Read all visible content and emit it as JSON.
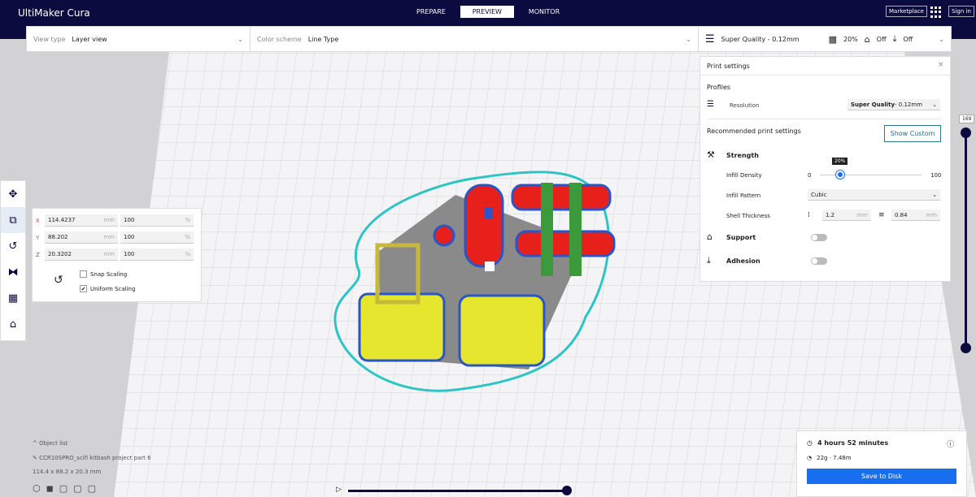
{
  "app": {
    "title": "UltiMaker Cura",
    "nav": [
      "PREPARE",
      "PREVIEW",
      "MONITOR"
    ],
    "active": "PREVIEW",
    "marketplace": "Marketplace",
    "signin": "Sign in"
  },
  "viewbar": {
    "view_type_label": "View type",
    "view_type": "Layer view",
    "color_scheme_label": "Color scheme",
    "color_scheme": "Line Type"
  },
  "summary": {
    "profile": "Super Quality - 0.12mm",
    "infill": "20%",
    "support": "Off",
    "adhesion": "Off"
  },
  "print_settings": {
    "title": "Print settings",
    "profiles": "Profiles",
    "resolution_label": "Resolution",
    "resolution_bold": "Super Quality",
    "resolution_rest": " - 0.12mm",
    "recommended": "Recommended print settings",
    "show_custom": "Show Custom",
    "strength": "Strength",
    "infill_density": "Infill Density",
    "infill_min": "0",
    "infill_max": "100",
    "infill_value": "20%",
    "infill_percent": 20,
    "infill_pattern_label": "Infill Pattern",
    "infill_pattern": "Cubic",
    "shell_label": "Shell Thickness",
    "wall": "1.2",
    "top_bottom": "0.84",
    "unit": "mm",
    "support": "Support",
    "support_on": false,
    "adhesion": "Adhesion",
    "adhesion_on": false
  },
  "layer_slider": {
    "value": "169"
  },
  "scale_tool": {
    "rows": [
      {
        "axis": "X",
        "mm": "114.4237",
        "pct": "100"
      },
      {
        "axis": "Y",
        "mm": "88.202",
        "pct": "100"
      },
      {
        "axis": "Z",
        "mm": "20.3202",
        "pct": "100"
      }
    ],
    "mm": "mm",
    "pct": "%",
    "snap": "Snap Scaling",
    "snap_checked": false,
    "uniform": "Uniform Scaling",
    "uniform_checked": true
  },
  "object_list": {
    "label": "Object list",
    "object": "CCR10SPRO_scifi kitbash project part 6",
    "dimensions": "114.4 x 88.2 x 20.3 mm"
  },
  "estimate": {
    "time": "4 hours 52 minutes",
    "material": "22g · 7.48m",
    "save": "Save to Disk"
  },
  "colors": {
    "brand": "#0b0b3f",
    "accent": "#196ef0",
    "wall": "#e8201c",
    "infill": "#e6e62e",
    "skirt": "#2ec4c4"
  }
}
